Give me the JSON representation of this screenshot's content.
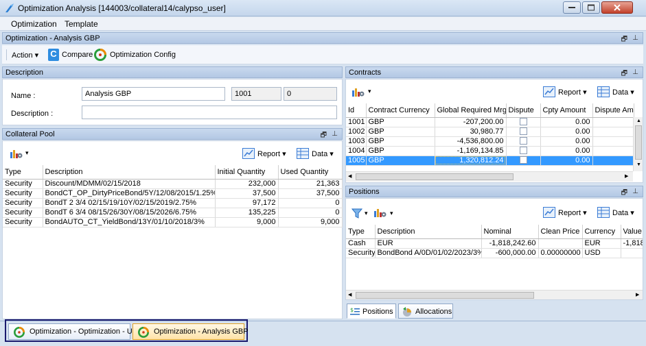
{
  "window": {
    "title": "Optimization Analysis [144003/collateral14/calypso_user]"
  },
  "menu": [
    "Optimization",
    "Template"
  ],
  "main_panel": {
    "title": "Optimization - Analysis GBP"
  },
  "toolbar": {
    "action_label": "Action",
    "compare_label": "Compare",
    "config_label": "Optimization Config"
  },
  "description": {
    "header": "Description",
    "name_label": "Name :",
    "name_value": "Analysis GBP",
    "id_value": "1001",
    "version_value": "0",
    "description_label": "Description :",
    "description_value": ""
  },
  "collateral_pool": {
    "header": "Collateral Pool",
    "report_label": "Report",
    "data_label": "Data",
    "columns": [
      "Type",
      "Description",
      "Initial Quantity",
      "Used Quantity"
    ],
    "rows": [
      [
        "Security",
        "Discount/MDMM/02/15/2018",
        "232,000",
        "21,363"
      ],
      [
        "Security",
        "BondCT_OP_DirtyPriceBond/5Y/12/08/2015/1.25%",
        "37,500",
        "37,500"
      ],
      [
        "Security",
        "BondT 2 3/4 02/15/19/10Y/02/15/2019/2.75%",
        "97,172",
        "0"
      ],
      [
        "Security",
        "BondT 6 3/4 08/15/26/30Y/08/15/2026/6.75%",
        "135,225",
        "0"
      ],
      [
        "Security",
        "BondAUTO_CT_YieldBond/13Y/01/10/2018/3%",
        "9,000",
        "9,000"
      ]
    ]
  },
  "contracts": {
    "header": "Contracts",
    "report_label": "Report",
    "data_label": "Data",
    "columns": [
      "Id",
      "Contract Currency",
      "Global Required Mrg",
      "Dispute",
      "Cpty Amount",
      "Dispute Amo"
    ],
    "rows": [
      [
        "1001",
        "GBP",
        "-207,200.00",
        "",
        "0.00",
        ""
      ],
      [
        "1002",
        "GBP",
        "30,980.77",
        "",
        "0.00",
        ""
      ],
      [
        "1003",
        "GBP",
        "-4,536,800.00",
        "",
        "0.00",
        ""
      ],
      [
        "1004",
        "GBP",
        "-1,169,134.85",
        "",
        "0.00",
        ""
      ],
      [
        "1005",
        "GBP",
        "1,320,812.24",
        "",
        "0.00",
        ""
      ]
    ],
    "selected_index": 4
  },
  "positions": {
    "header": "Positions",
    "report_label": "Report",
    "data_label": "Data",
    "columns": [
      "Type",
      "Description",
      "Nominal",
      "Clean Price",
      "Currency",
      "Value"
    ],
    "rows": [
      [
        "Cash",
        "EUR",
        "-1,818,242.60",
        "",
        "EUR",
        "-1,818"
      ],
      [
        "Security",
        "BondBond A/0D/01/02/2023/3%",
        "-600,000.00",
        "0.00000000",
        "USD",
        ""
      ]
    ],
    "tabs": [
      "Positions",
      "Allocations"
    ]
  },
  "bottom_tabs": [
    "Optimization - Optimization - USD",
    "Optimization - Analysis GBP"
  ],
  "colors": {
    "selection": "#3399ff",
    "header": "#b3c8e4",
    "accent_orange": "#f08a00",
    "highlight_border": "#1a1a6e"
  }
}
